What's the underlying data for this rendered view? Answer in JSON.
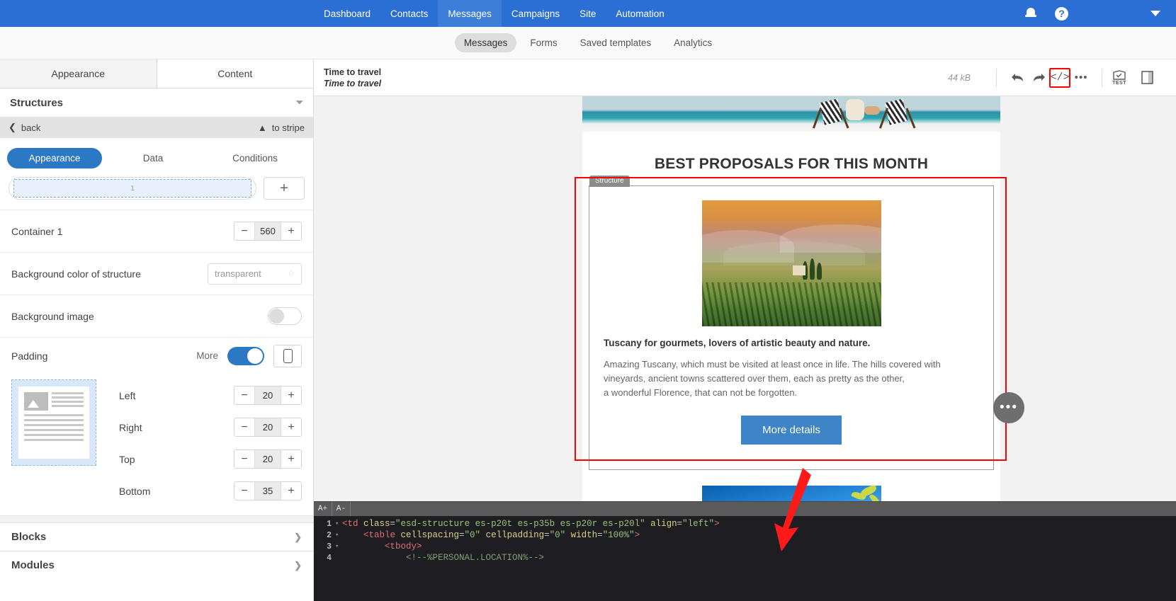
{
  "topnav": {
    "items": [
      {
        "label": "Dashboard",
        "active": false
      },
      {
        "label": "Contacts",
        "active": false
      },
      {
        "label": "Messages",
        "active": true
      },
      {
        "label": "Campaigns",
        "active": false
      },
      {
        "label": "Site",
        "active": false
      },
      {
        "label": "Automation",
        "active": false
      }
    ],
    "bell": "bell-icon",
    "help": "?",
    "caret": "chevron-down-icon",
    "brand_color": "#2b6fd4"
  },
  "subnav": {
    "items": [
      {
        "label": "Messages",
        "active": true
      },
      {
        "label": "Forms",
        "active": false
      },
      {
        "label": "Saved templates",
        "active": false
      },
      {
        "label": "Analytics",
        "active": false
      }
    ]
  },
  "sidebar": {
    "tabs": [
      {
        "label": "Appearance",
        "active": true
      },
      {
        "label": "Content",
        "active": false
      }
    ],
    "section_title": "Structures",
    "back_label": "back",
    "to_stripe_label": "to stripe",
    "pills": [
      {
        "label": "Appearance",
        "active": true
      },
      {
        "label": "Data",
        "active": false
      },
      {
        "label": "Conditions",
        "active": false
      }
    ],
    "structure_cell_label": "1",
    "add_label": "+",
    "container": {
      "label": "Container 1",
      "value": "560"
    },
    "bg_color": {
      "label": "Background color of structure",
      "value": "transparent"
    },
    "bg_image": {
      "label": "Background image",
      "enabled": false
    },
    "padding": {
      "label": "Padding",
      "more_label": "More",
      "more_enabled": true,
      "fields": [
        {
          "label": "Left",
          "value": "20"
        },
        {
          "label": "Right",
          "value": "20"
        },
        {
          "label": "Top",
          "value": "20"
        },
        {
          "label": "Bottom",
          "value": "35"
        }
      ]
    },
    "collapsibles": [
      {
        "label": "Blocks"
      },
      {
        "label": "Modules"
      }
    ]
  },
  "editor_bar": {
    "subject": "Time to travel",
    "preheader": "Time to travel",
    "filesize": "44 kB",
    "undo": "undo-icon",
    "redo": "redo-icon",
    "code": "</>",
    "more": "•••",
    "test_label": "TEST",
    "preview": "preview-icon"
  },
  "email": {
    "heading": "BEST PROPOSALS FOR THIS MONTH",
    "structure_tag": "Structure",
    "block_title": "Tuscany for gourmets, lovers of artistic beauty and nature.",
    "paragraph_lines": [
      "Amazing Tuscany, which must be visited at least once in life. The hills covered with",
      "vineyards, ancient towns scattered over them, each as pretty as the other,",
      "a wonderful Florence, that can not be forgotten."
    ],
    "cta_label": "More details",
    "cta_color": "#3d85c6",
    "float_more": "•••",
    "selection_color": "#ff0000"
  },
  "code_editor": {
    "font_inc": "A+",
    "font_dec": "A-",
    "lines": [
      {
        "num": "1",
        "fold": true,
        "parts": [
          {
            "t": "<td ",
            "c": "tag"
          },
          {
            "t": "class",
            "c": "attr"
          },
          {
            "t": "=",
            "c": "punct"
          },
          {
            "t": "\"esd-structure es-p20t es-p35b es-p20r es-p20l\"",
            "c": "val"
          },
          {
            "t": " align",
            "c": "attr"
          },
          {
            "t": "=",
            "c": "punct"
          },
          {
            "t": "\"left\"",
            "c": "val"
          },
          {
            "t": ">",
            "c": "tag"
          }
        ]
      },
      {
        "num": "2",
        "fold": true,
        "parts": [
          {
            "t": "    <table ",
            "c": "tag"
          },
          {
            "t": "cellspacing",
            "c": "attr"
          },
          {
            "t": "=",
            "c": "punct"
          },
          {
            "t": "\"0\"",
            "c": "val"
          },
          {
            "t": " cellpadding",
            "c": "attr"
          },
          {
            "t": "=",
            "c": "punct"
          },
          {
            "t": "\"0\"",
            "c": "val"
          },
          {
            "t": " width",
            "c": "attr"
          },
          {
            "t": "=",
            "c": "punct"
          },
          {
            "t": "\"100%\"",
            "c": "val"
          },
          {
            "t": ">",
            "c": "tag"
          }
        ]
      },
      {
        "num": "3",
        "fold": true,
        "parts": [
          {
            "t": "        <tbody>",
            "c": "tag"
          }
        ]
      },
      {
        "num": "4",
        "fold": false,
        "parts": [
          {
            "t": "            <!--%PERSONAL.LOCATION%-->",
            "c": "cmt"
          }
        ]
      }
    ]
  }
}
